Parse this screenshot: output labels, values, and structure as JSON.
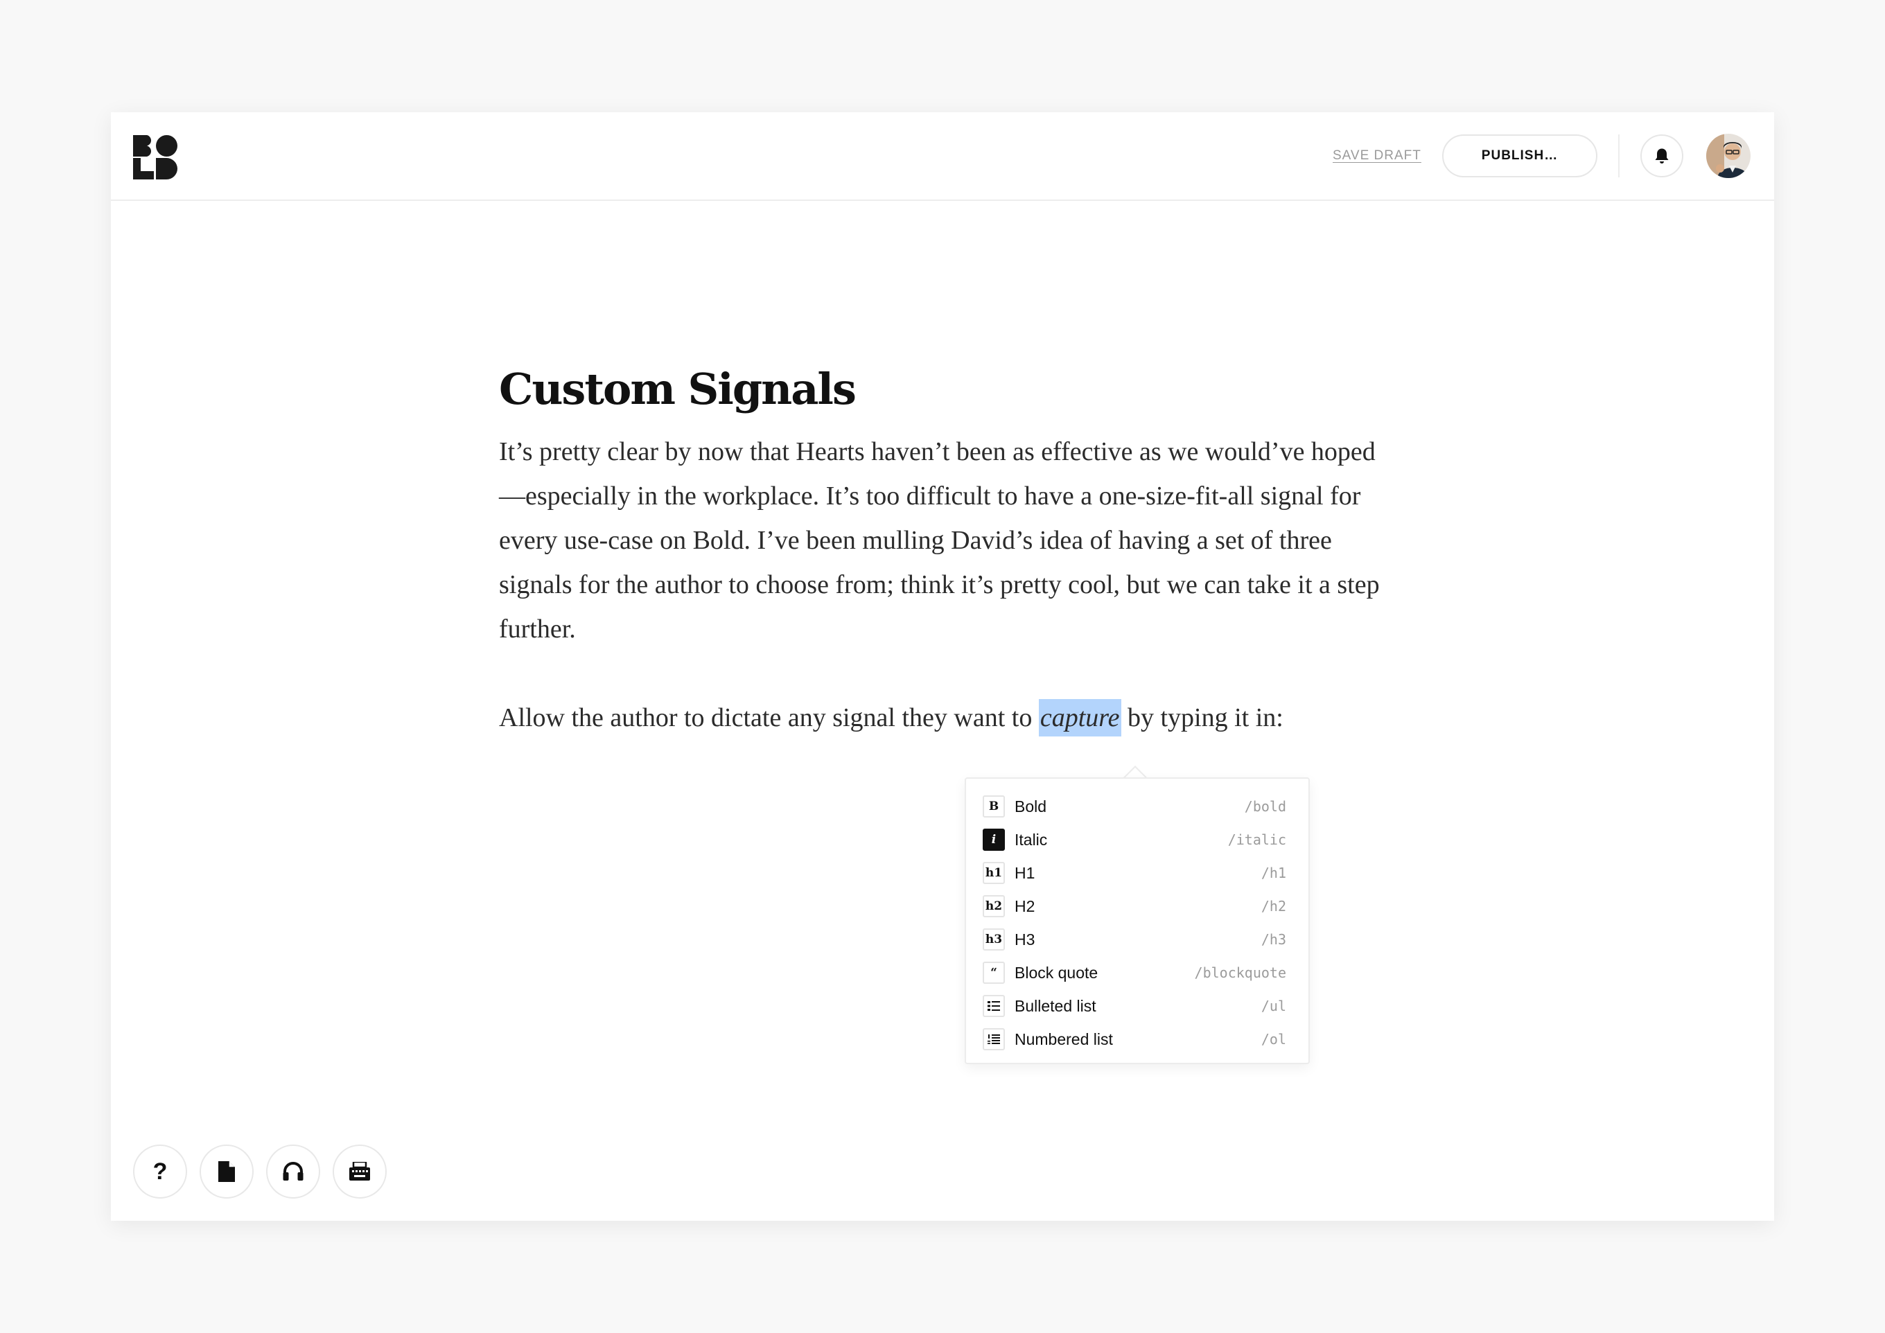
{
  "header": {
    "logo_text": "BOLD",
    "save_draft_label": "SAVE DRAFT",
    "publish_label": "PUBLISH…",
    "notifications_icon": "bell-icon",
    "avatar_icon": "user-avatar"
  },
  "document": {
    "title": "Custom Signals",
    "paragraph1": "It’s pretty clear by now that Hearts haven’t been as effective as we would’ve hoped—especially in the workplace. It’s too difficult to have a one-size-fit-all signal for every use-case on Bold. I’ve been mulling David’s idea of having a set of three signals for the author to choose from; think it’s pretty cool, but we can take it a step further.",
    "paragraph2_before": "Allow the author to dictate any signal they want to ",
    "paragraph2_selected": "capture",
    "paragraph2_after": " by typing it in:"
  },
  "format_menu": {
    "items": [
      {
        "icon_glyph": "B",
        "icon": "bold-icon",
        "label": "Bold",
        "shortcut": "/bold",
        "active": false
      },
      {
        "icon_glyph": "i",
        "icon": "italic-icon",
        "label": "Italic",
        "shortcut": "/italic",
        "active": true
      },
      {
        "icon_glyph": "h1",
        "icon": "h1-icon",
        "label": "H1",
        "shortcut": "/h1",
        "active": false
      },
      {
        "icon_glyph": "h2",
        "icon": "h2-icon",
        "label": "H2",
        "shortcut": "/h2",
        "active": false
      },
      {
        "icon_glyph": "h3",
        "icon": "h3-icon",
        "label": "H3",
        "shortcut": "/h3",
        "active": false
      },
      {
        "icon_glyph": "“",
        "icon": "quote-icon",
        "label": "Block quote",
        "shortcut": "/blockquote",
        "active": false
      },
      {
        "icon_glyph": "",
        "icon": "bulleted-list-icon",
        "label": "Bulleted list",
        "shortcut": "/ul",
        "active": false
      },
      {
        "icon_glyph": "",
        "icon": "numbered-list-icon",
        "label": "Numbered list",
        "shortcut": "/ol",
        "active": false
      }
    ]
  },
  "bottom_toolbar": {
    "help_glyph": "?",
    "icons": [
      "help-icon",
      "document-icon",
      "headphones-icon",
      "typewriter-icon"
    ]
  },
  "colors": {
    "selection": "#b3d4fc",
    "border": "#ececec",
    "text": "#111111"
  }
}
